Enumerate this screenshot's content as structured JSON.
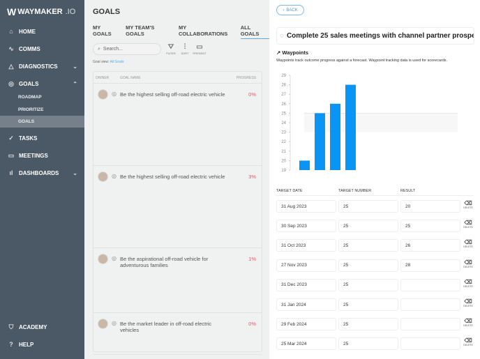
{
  "sidebar": {
    "logo": "WAYMAKER",
    "logo_suffix": ".IO",
    "items": [
      {
        "label": "HOME",
        "icon": "home-icon",
        "glyph": "⌂"
      },
      {
        "label": "COMMS",
        "icon": "pulse-icon",
        "glyph": "∿"
      },
      {
        "label": "DIAGNOSTICS",
        "icon": "triangle-icon",
        "glyph": "△",
        "chevron": "⌄"
      },
      {
        "label": "GOALS",
        "icon": "target-icon",
        "glyph": "◎",
        "chevron": "⌃"
      },
      {
        "label": "TASKS",
        "icon": "check-circle-icon",
        "glyph": "✓"
      },
      {
        "label": "MEETINGS",
        "icon": "calendar-icon",
        "glyph": "▭"
      },
      {
        "label": "DASHBOARDS",
        "icon": "bar-chart-icon",
        "glyph": "ıl",
        "chevron": "⌄"
      },
      {
        "label": "ACADEMY",
        "icon": "shield-icon",
        "glyph": "⛉"
      },
      {
        "label": "HELP",
        "icon": "help-icon",
        "glyph": "?"
      }
    ],
    "sub": [
      "ROADMAP",
      "PRIORITIZE",
      "GOALS"
    ]
  },
  "main": {
    "title": "GOALS",
    "tabs": [
      "MY GOALS",
      "MY TEAM'S GOALS",
      "MY COLLABORATIONS",
      "ALL GOALS"
    ],
    "search_placeholder": "Search...",
    "tools": [
      "FILTER",
      "SORT",
      "PRESENT"
    ],
    "goal_view_label": "Goal view:",
    "goal_view_value": "All Goals",
    "columns": [
      "OWNER",
      "GOAL NAME",
      "PROGRESS"
    ],
    "goals": [
      {
        "name": "Be the highest selling off-road electric vehicle",
        "progress": "0%"
      },
      {
        "name": "Be the highest selling off-road electric vehicle",
        "progress": "3%"
      },
      {
        "name": "Be the aspirational off-road vehicle for adventurous families",
        "progress": "1%"
      },
      {
        "name": "Be the market leader in off-road electric vehicles",
        "progress": "0%"
      }
    ]
  },
  "detail": {
    "back": "BACK",
    "goal_title": "Complete 25 sales meetings with channel partner prospects per month",
    "waypoints_title": "Waypoints",
    "waypoints_desc": "Waypoints track outcome progress against a forecast. Waypoint tracking data is used for scorecards.",
    "columns": [
      "TARGET DATE",
      "TARGET NUMBER",
      "RESULT"
    ],
    "delete_label": "DELETE",
    "rows": [
      {
        "date": "31 Aug 2023",
        "target": "25",
        "result": "20"
      },
      {
        "date": "30 Sep 2023",
        "target": "25",
        "result": "25"
      },
      {
        "date": "31 Oct 2023",
        "target": "25",
        "result": "26"
      },
      {
        "date": "27 Nov 2023",
        "target": "25",
        "result": "28"
      },
      {
        "date": "31 Dec 2023",
        "target": "25",
        "result": ""
      },
      {
        "date": "31 Jan 2024",
        "target": "25",
        "result": ""
      },
      {
        "date": "29 Feb 2024",
        "target": "25",
        "result": ""
      },
      {
        "date": "25 Mar 2024",
        "target": "25",
        "result": ""
      }
    ]
  },
  "chart_data": {
    "type": "bar",
    "categories": [
      "31 Aug 2023",
      "30 Sep 2023",
      "31 Oct 2023",
      "27 Nov 2023"
    ],
    "values": [
      20,
      25,
      26,
      28
    ],
    "target": 25,
    "ylim": [
      19,
      29
    ],
    "yticks": [
      19,
      20,
      21,
      22,
      23,
      24,
      25,
      26,
      27,
      28,
      29
    ],
    "bar_color": "#0a95f5",
    "grid": false
  }
}
